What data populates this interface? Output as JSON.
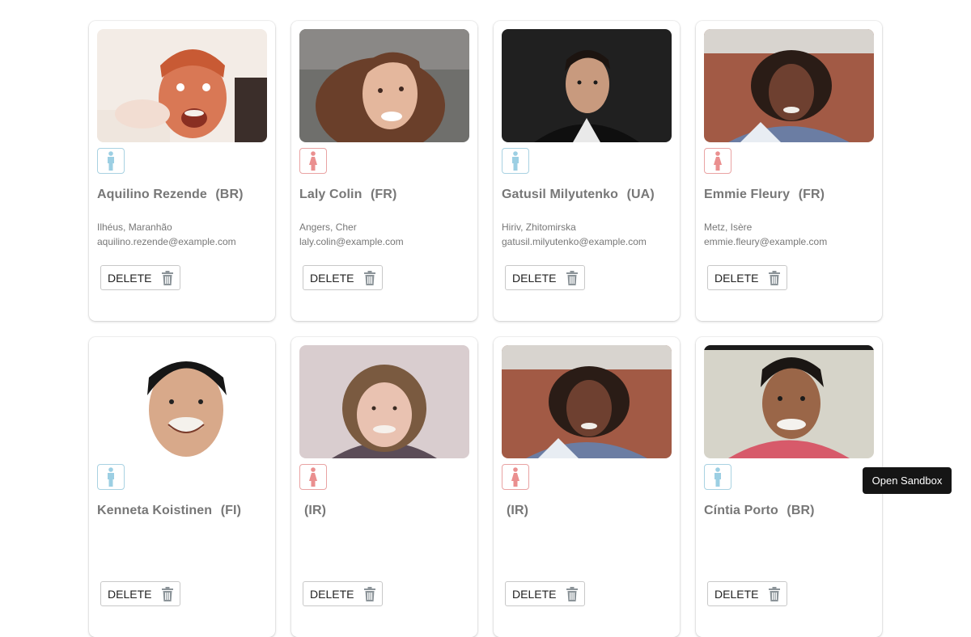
{
  "users": [
    {
      "name": "Aquilino Rezende",
      "country": "(BR)",
      "city": "Ilhéus, Maranhão",
      "email": "aquilino.rezende@example.com",
      "gender": "male",
      "delete_label": "DELETE",
      "icon": "male-icon"
    },
    {
      "name": "Laly Colin",
      "country": "(FR)",
      "city": "Angers, Cher",
      "email": "laly.colin@example.com",
      "gender": "female",
      "delete_label": "DELETE",
      "icon": "female-icon"
    },
    {
      "name": "Gatusil Milyutenko",
      "country": "(UA)",
      "city": "Hiriv, Zhitomirska",
      "email": "gatusil.milyutenko@example.com",
      "gender": "male",
      "delete_label": "DELETE",
      "icon": "male-icon"
    },
    {
      "name": "Emmie Fleury",
      "country": "(FR)",
      "city": "Metz, Isère",
      "email": "emmie.fleury@example.com",
      "gender": "female",
      "delete_label": "DELETE",
      "icon": "female-icon"
    },
    {
      "name": "Kenneta Koistinen",
      "country": "(FI)",
      "city": "",
      "email": "",
      "gender": "male",
      "delete_label": "DELETE",
      "icon": "male-icon"
    },
    {
      "name": "",
      "country": "(IR)",
      "city": "",
      "email": "",
      "gender": "female",
      "delete_label": "DELETE",
      "icon": "female-icon"
    },
    {
      "name": "",
      "country": "(IR)",
      "city": "",
      "email": "",
      "gender": "female",
      "delete_label": "DELETE",
      "icon": "female-icon"
    },
    {
      "name": "Cíntia Porto",
      "country": "(BR)",
      "city": "",
      "email": "",
      "gender": "male",
      "delete_label": "DELETE",
      "icon": "male-icon"
    }
  ],
  "sandbox_button": "Open Sandbox",
  "colors": {
    "male": "#9ccfe3",
    "female": "#ea8f8f",
    "trash": "#8c9499"
  }
}
